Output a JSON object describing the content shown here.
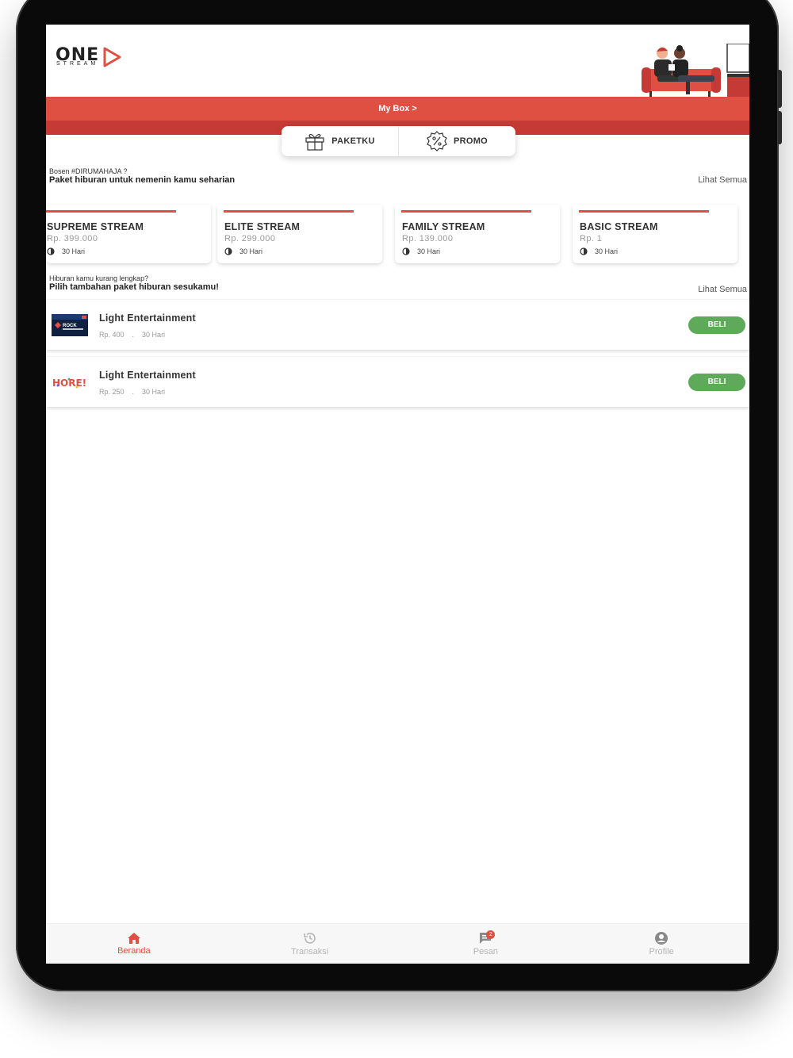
{
  "header": {
    "logo_primary": "ONE",
    "logo_secondary": "STREAM",
    "mybox_label": "My Box >"
  },
  "tabs": [
    {
      "label": "PAKETKU",
      "icon": "gift-icon"
    },
    {
      "label": "PROMO",
      "icon": "percent-badge-icon"
    }
  ],
  "main_section": {
    "subtitle": "Bosen #DIRUMAHAJA ?",
    "title": "Paket hiburan untuk nemenin kamu seharian",
    "see_all": "Lihat Semua"
  },
  "packages": [
    {
      "name": "SUPREME STREAM",
      "price": "Rp. 399.000",
      "duration": "30 Hari"
    },
    {
      "name": "ELITE STREAM",
      "price": "Rp. 299.000",
      "duration": "30 Hari"
    },
    {
      "name": "FAMILY STREAM",
      "price": "Rp. 139.000",
      "duration": "30 Hari"
    },
    {
      "name": "BASIC STREAM",
      "price": "Rp. 1",
      "duration": "30 Hari"
    }
  ],
  "addon_section": {
    "subtitle": "Hiburan kamu kurang lengkap?",
    "title": "Pilih tambahan paket hiburan sesukamu!",
    "see_all": "Lihat Semua"
  },
  "addons": [
    {
      "title": "Light Entertainment",
      "price": "Rp. 400",
      "separator": ".",
      "duration": "30 Hari",
      "button": "BELI",
      "logo_text": "ROCK"
    },
    {
      "title": "Light Entertainment",
      "price": "Rp. 250",
      "separator": ".",
      "duration": "30 Hari",
      "button": "BELI",
      "logo_text": "HORE!"
    }
  ],
  "bottom_nav": [
    {
      "label": "Beranda",
      "icon": "home-icon",
      "active": true
    },
    {
      "label": "Transaksi",
      "icon": "history-icon",
      "active": false
    },
    {
      "label": "Pesan",
      "icon": "message-icon",
      "active": false,
      "badge": "2"
    },
    {
      "label": "Profile",
      "icon": "profile-icon",
      "active": false
    }
  ],
  "colors": {
    "accent": "#e05042",
    "accent_dark": "#c63a35",
    "buy_button": "#5fa95a"
  }
}
